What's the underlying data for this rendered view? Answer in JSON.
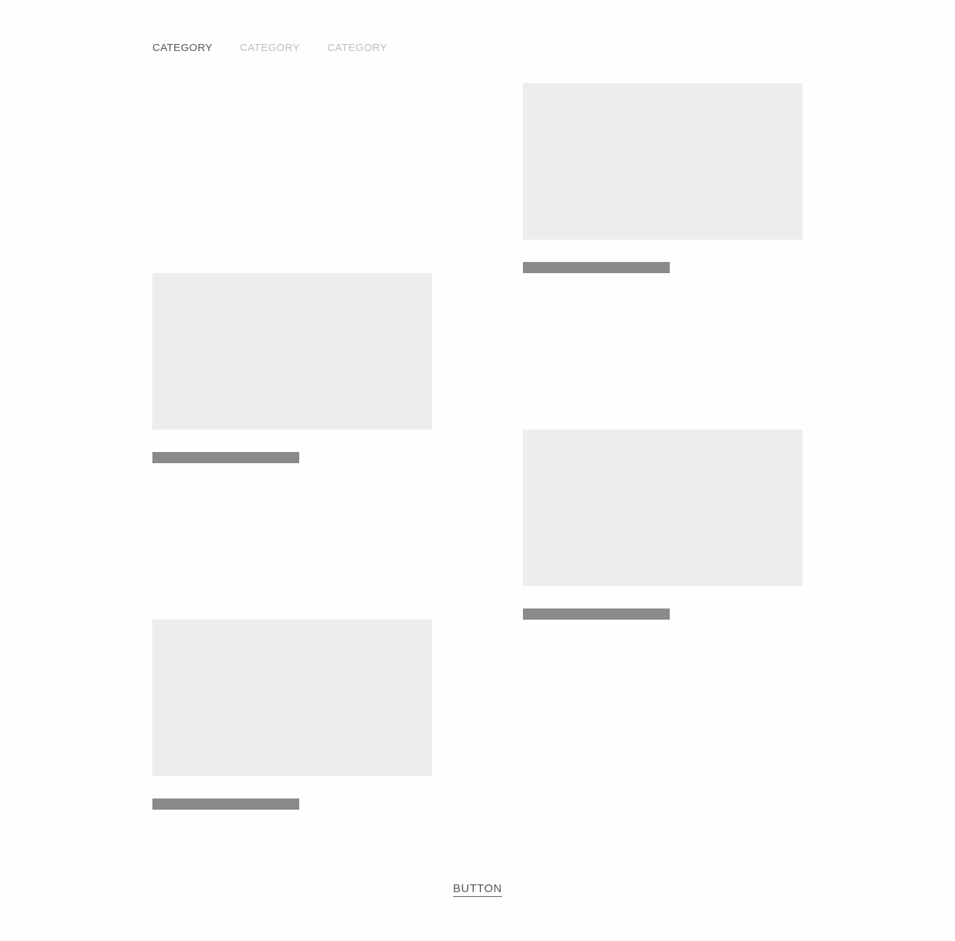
{
  "categories": [
    {
      "label": "CATEGORY",
      "active": true
    },
    {
      "label": "CATEGORY",
      "active": false
    },
    {
      "label": "CATEGORY",
      "active": false
    }
  ],
  "colors": {
    "background": "#fefefe",
    "placeholder_image": "#ededed",
    "placeholder_title": "#8a8a8a",
    "active_tab": "#555555",
    "inactive_tab": "#bdbdbd"
  },
  "footer": {
    "button_label": "BUTTON"
  }
}
